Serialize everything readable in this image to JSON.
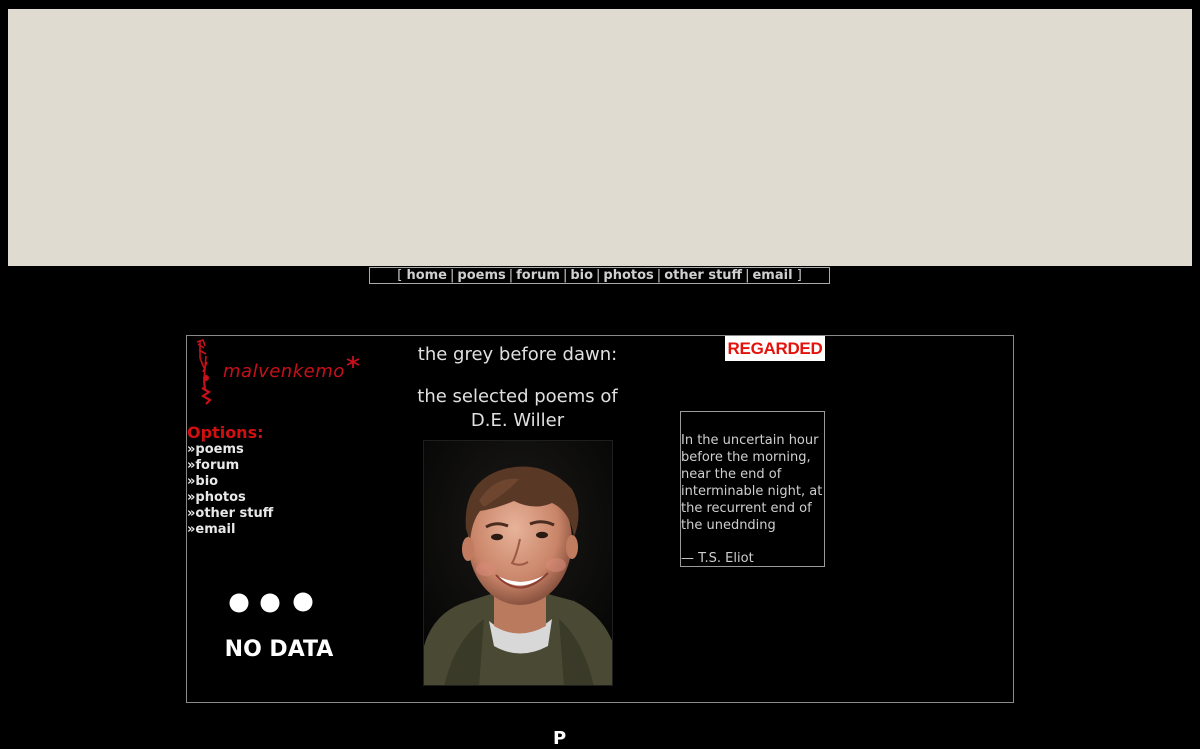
{
  "topnav": {
    "open_bracket": "[",
    "close_bracket": "]",
    "separator": "|",
    "items": [
      "home",
      "poems",
      "forum",
      "bio",
      "photos",
      "other stuff",
      "email"
    ]
  },
  "logo": {
    "text": "malvenkemo"
  },
  "options": {
    "heading": "Options:",
    "items": [
      "»poems",
      "»forum",
      "»bio",
      "»photos",
      "»other stuff",
      "»email"
    ]
  },
  "nodata": {
    "label": "NO DATA"
  },
  "title": {
    "line1": "the grey before dawn:",
    "line2a": "the selected poems of",
    "line2b": "D.E. Willer"
  },
  "badge": {
    "text": "REGARDED"
  },
  "quote": {
    "text": "In the uncertain hour before the morning, near the end of interminable night, at the recurrent end of the unednding",
    "attribution": "— T.S. Eliot"
  },
  "footer": {
    "partial_char": "P"
  },
  "colors": {
    "banner": "#dfdbd0",
    "accent_red": "#d01010",
    "background": "#000000"
  }
}
